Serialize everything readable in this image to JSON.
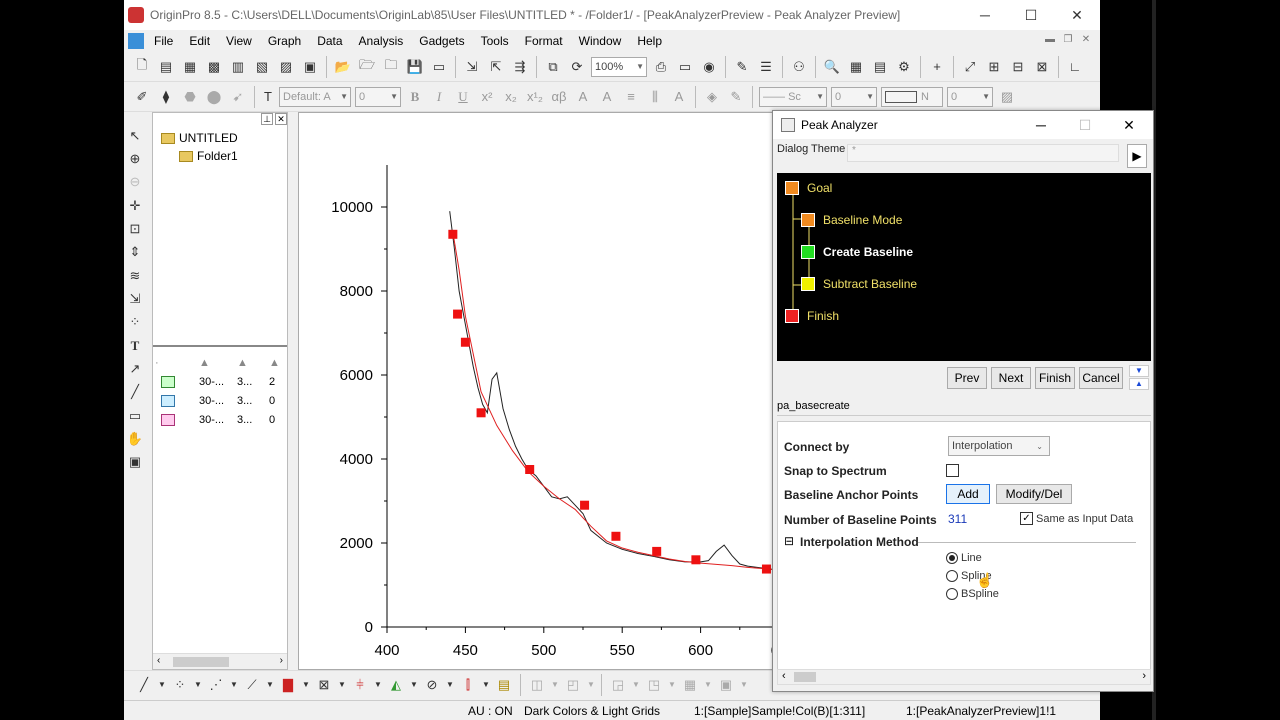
{
  "window": {
    "title": "OriginPro 8.5 - C:\\Users\\DELL\\Documents\\OriginLab\\85\\User Files\\UNTITLED * - /Folder1/ - [PeakAnalyzerPreview - Peak Analyzer Preview]",
    "minimize": "─",
    "maximize": "☐",
    "close": "✕"
  },
  "menu": [
    "File",
    "Edit",
    "View",
    "Graph",
    "Data",
    "Analysis",
    "Gadgets",
    "Tools",
    "Format",
    "Window",
    "Help"
  ],
  "toolbar": {
    "zoom": "100%",
    "font": "Default: A",
    "fontsize": "0",
    "linestyle": "Sc",
    "linewidth": "0",
    "n_field": "N",
    "num_field": "0"
  },
  "project": {
    "root": "UNTITLED",
    "folder": "Folder1",
    "rows": [
      {
        "c1": "30-...",
        "c2": "3...",
        "c3": "2"
      },
      {
        "c1": "30-...",
        "c2": "3...",
        "c3": "0"
      },
      {
        "c1": "30-...",
        "c2": "3...",
        "c3": "0"
      }
    ]
  },
  "chart_data": {
    "type": "line",
    "xlabel": "",
    "ylabel": "",
    "xlim": [
      400,
      650
    ],
    "ylim": [
      0,
      10000
    ],
    "xticks": [
      "400",
      "450",
      "500",
      "550",
      "600",
      "65"
    ],
    "yticks": [
      "0",
      "2000",
      "4000",
      "6000",
      "8000",
      "10000"
    ],
    "series": [
      {
        "values_x": [
          440,
          443,
          446,
          449,
          452,
          455,
          458,
          461,
          464,
          467,
          470,
          474,
          478,
          482,
          486,
          490,
          495,
          500,
          505,
          510,
          515,
          520,
          525,
          530,
          540,
          550,
          560,
          570,
          580,
          590,
          600,
          605,
          610,
          615,
          620,
          625,
          630,
          640,
          650
        ],
        "values_y": [
          9900,
          9000,
          8000,
          7400,
          6800,
          6200,
          5700,
          5300,
          5100,
          5900,
          6050,
          5200,
          4700,
          4300,
          4000,
          3750,
          3600,
          3350,
          3100,
          3050,
          3100,
          2900,
          2700,
          2300,
          2000,
          1850,
          1750,
          1680,
          1600,
          1550,
          1550,
          1580,
          1800,
          1950,
          1700,
          1500,
          1450,
          1400,
          1350
        ]
      },
      {
        "values_x": [
          442,
          446,
          450,
          455,
          460,
          470,
          480,
          490,
          500,
          510,
          520,
          530,
          540,
          550,
          560,
          570,
          580,
          590,
          600,
          610,
          620,
          630,
          640,
          650
        ],
        "values_y": [
          9400,
          8500,
          7400,
          6500,
          5600,
          4800,
          4200,
          3700,
          3350,
          3050,
          2800,
          2400,
          2050,
          1880,
          1780,
          1700,
          1620,
          1560,
          1520,
          1490,
          1460,
          1420,
          1390,
          1360
        ]
      }
    ],
    "anchors": {
      "x": [
        442,
        445,
        450,
        460,
        491,
        526,
        546,
        572,
        597,
        642
      ],
      "y": [
        9350,
        7450,
        6780,
        5100,
        3750,
        2900,
        2160,
        1800,
        1600,
        1380
      ]
    },
    "colors": {
      "data": "#222222",
      "baseline": "#e02020",
      "anchor": "#ee1111"
    }
  },
  "bottom_toolbar_icons": [
    "line",
    "dot",
    "scatter",
    "bar",
    "area",
    "pie",
    "contour",
    "3d"
  ],
  "status": {
    "au": "AU : ON",
    "theme": "Dark Colors & Light Grids",
    "col": "1:[Sample]Sample!Col(B)[1:311]",
    "graph": "1:[PeakAnalyzerPreview]1!1"
  },
  "peak": {
    "title": "Peak Analyzer",
    "theme_label": "Dialog Theme",
    "theme_value": "*",
    "steps": [
      {
        "label": "Goal",
        "color": "#f08a20",
        "bold": false
      },
      {
        "label": "Baseline Mode",
        "color": "#f08a20",
        "bold": false
      },
      {
        "label": "Create Baseline",
        "color": "#22dd22",
        "bold": true
      },
      {
        "label": "Subtract Baseline",
        "color": "#f0f000",
        "bold": false
      },
      {
        "label": "Finish",
        "color": "#ee2222",
        "bold": false
      }
    ],
    "buttons": {
      "prev": "Prev",
      "next": "Next",
      "finish": "Finish",
      "cancel": "Cancel"
    },
    "opname": "pa_basecreate",
    "connect_by_label": "Connect by",
    "connect_by_value": "Interpolation",
    "snap_label": "Snap to Spectrum",
    "anchor_label": "Baseline Anchor Points",
    "add": "Add",
    "modify": "Modify/Del",
    "num_label": "Number of Baseline Points",
    "num_value": "311",
    "same_label": "Same as Input Data",
    "interp_label": "Interpolation Method",
    "interp_toggle": "⊟",
    "radios": [
      "Line",
      "Spline",
      "BSpline"
    ],
    "selected": "Line"
  }
}
